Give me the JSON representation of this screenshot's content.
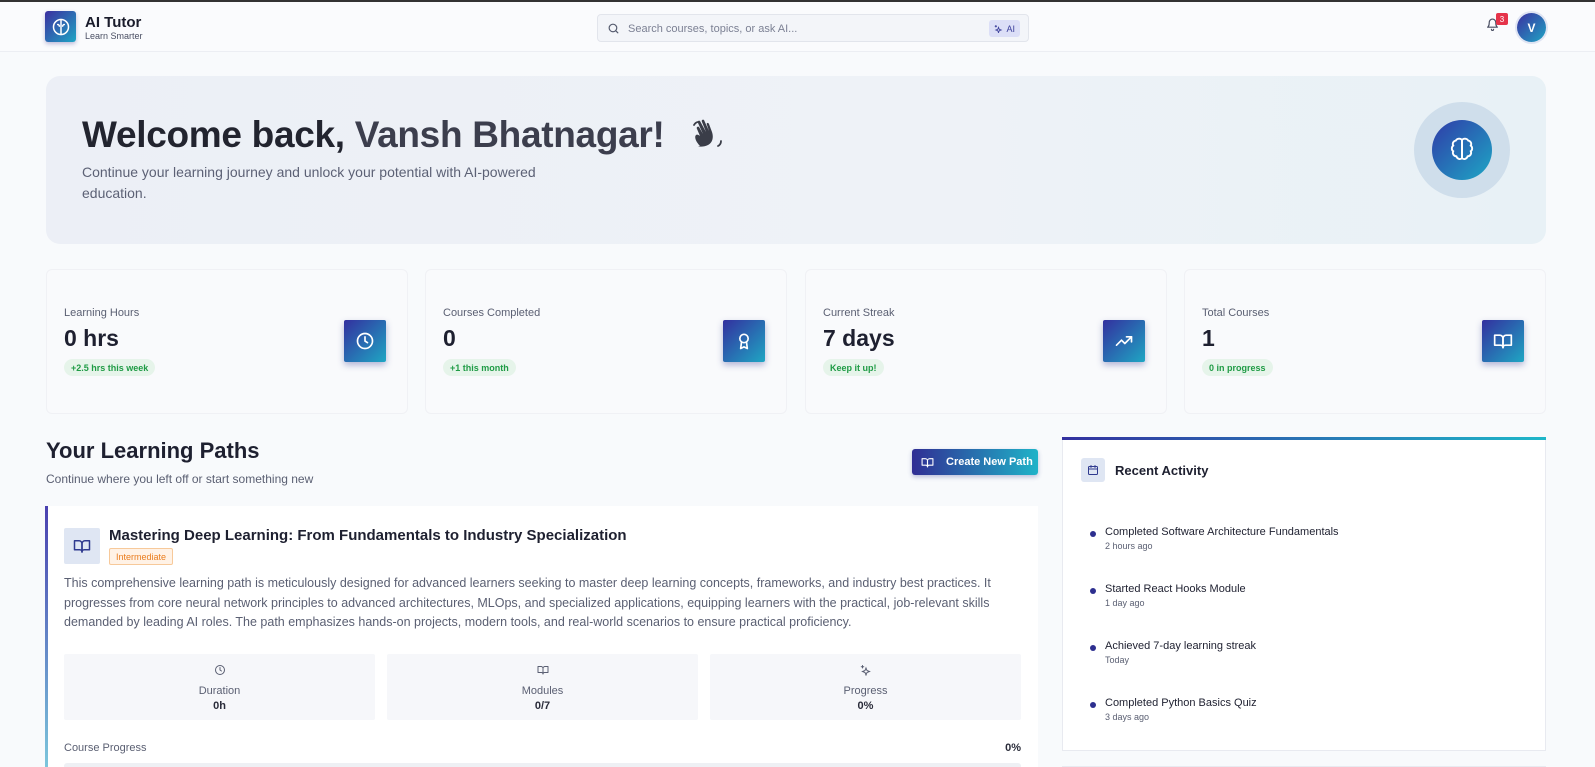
{
  "app": {
    "title": "AI Tutor",
    "subtitle": "Learn Smarter"
  },
  "search": {
    "placeholder": "Search courses, topics, or ask AI...",
    "ai_badge": "AI"
  },
  "notifications": {
    "count": "3"
  },
  "user": {
    "initial": "V"
  },
  "hero": {
    "greeting": "Welcome back, ",
    "name": "Vansh Bhatnagar!",
    "description": "Continue your learning journey and unlock your potential with AI-powered education."
  },
  "stats": [
    {
      "label": "Learning Hours",
      "value": "0 hrs",
      "note": "+2.5 hrs this week",
      "icon": "clock-icon"
    },
    {
      "label": "Courses Completed",
      "value": "0",
      "note": "+1 this month",
      "icon": "award-icon"
    },
    {
      "label": "Current Streak",
      "value": "7 days",
      "note": "Keep it up!",
      "icon": "trending-up-icon"
    },
    {
      "label": "Total Courses",
      "value": "1",
      "note": "0 in progress",
      "icon": "book-open-icon"
    }
  ],
  "learning_paths": {
    "title": "Your Learning Paths",
    "subtitle": "Continue where you left off or start something new",
    "create_label": "Create New Path",
    "path": {
      "title": "Mastering Deep Learning: From Fundamentals to Industry Specialization",
      "level": "Intermediate",
      "description": "This comprehensive learning path is meticulously designed for advanced learners seeking to master deep learning concepts, frameworks, and industry best practices. It progresses from core neural network principles to advanced architectures, MLOps, and specialized applications, equipping learners with the practical, job-relevant skills demanded by leading AI roles. The path emphasizes hands-on projects, modern tools, and real-world scenarios to ensure practical proficiency.",
      "metrics": [
        {
          "label": "Duration",
          "value": "0h",
          "icon": "clock-icon"
        },
        {
          "label": "Modules",
          "value": "0/7",
          "icon": "book-open-icon"
        },
        {
          "label": "Progress",
          "value": "0%",
          "icon": "sparkles-icon"
        }
      ],
      "course_progress_label": "Course Progress",
      "course_progress_value": "0%",
      "course_progress_fraction": 0
    }
  },
  "recent_activity": {
    "title": "Recent Activity",
    "items": [
      {
        "text": "Completed Software Architecture Fundamentals",
        "time": "2 hours ago"
      },
      {
        "text": "Started React Hooks Module",
        "time": "1 day ago"
      },
      {
        "text": "Achieved 7-day learning streak",
        "time": "Today"
      },
      {
        "text": "Completed Python Basics Quiz",
        "time": "3 days ago"
      }
    ]
  },
  "colors": {
    "accent_start": "#33309f",
    "accent_end": "#1fb3c8",
    "success": "#1f9b45",
    "warning": "#ea7d1e",
    "danger": "#e5334a"
  }
}
